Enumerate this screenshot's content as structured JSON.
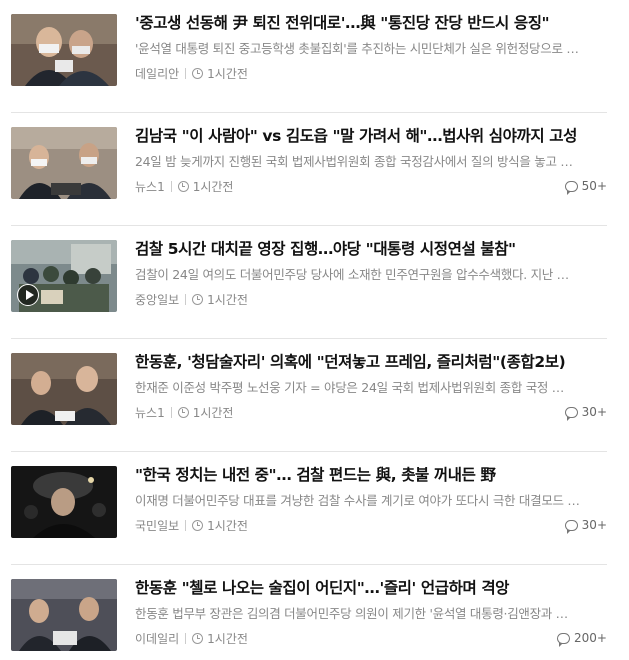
{
  "articles": [
    {
      "title": "'중고생 선동해 尹 퇴진 전위대로'…與 \"통진당 잔당 반드시 응징\"",
      "description": "'윤석열 대통령 퇴진 중고등학생 촛불집회'를 추진하는 시민단체가 실은 위헌정당으로 …",
      "source": "데일리안",
      "time": "1시간전",
      "comments": "",
      "thumb_icon": "photo-politicians-mask",
      "has_video": false
    },
    {
      "title": "김남국 \"이 사람아\" vs 김도읍 \"말 가려서 해\"…법사위 심야까지 고성",
      "description": "24일 밤 늦게까지 진행된 국회 법제사법위원회 종합 국정감사에서 질의 방식을 놓고 …",
      "source": "뉴스1",
      "time": "1시간전",
      "comments": "50+",
      "thumb_icon": "photo-assembly-session",
      "has_video": false
    },
    {
      "title": "검찰 5시간 대치끝 영장 집행…야당 \"대통령 시정연설 불참\"",
      "description": "검찰이 24일 여의도 더불어민주당 당사에 소재한 민주연구원을 압수수색했다. 지난 …",
      "source": "중앙일보",
      "time": "1시간전",
      "comments": "",
      "thumb_icon": "photo-police-crowd",
      "has_video": true
    },
    {
      "title": "한동훈, '청담술자리' 의혹에 \"던져놓고 프레임, 즐리처럼\"(종합2보)",
      "description": "한재준 이준성 박주평 노선웅 기자 = 야당은 24일 국회 법제사법위원회 종합 국정 …",
      "source": "뉴스1",
      "time": "1시간전",
      "comments": "30+",
      "thumb_icon": "photo-minister-hearing",
      "has_video": false
    },
    {
      "title": "\"한국 정치는 내전 중\"… 검찰 편드는 與, 촛불 꺼내든 野",
      "description": "이재명 더불어민주당 대표를 겨냥한 검찰 수사를 계기로 여야가 또다시 극한 대결모드 …",
      "source": "국민일보",
      "time": "1시간전",
      "comments": "30+",
      "thumb_icon": "photo-night-crowd",
      "has_video": false
    },
    {
      "title": "한동훈 \"첼로 나오는 술집이 어딘지\"…'즐리' 언급하며 격앙",
      "description": "한동훈 법무부 장관은 김의겸 더불어민주당 의원이 제기한 '윤석열 대통령·김앤장과 …",
      "source": "이데일리",
      "time": "1시간전",
      "comments": "200+",
      "thumb_icon": "photo-hearing-room",
      "has_video": false
    }
  ]
}
